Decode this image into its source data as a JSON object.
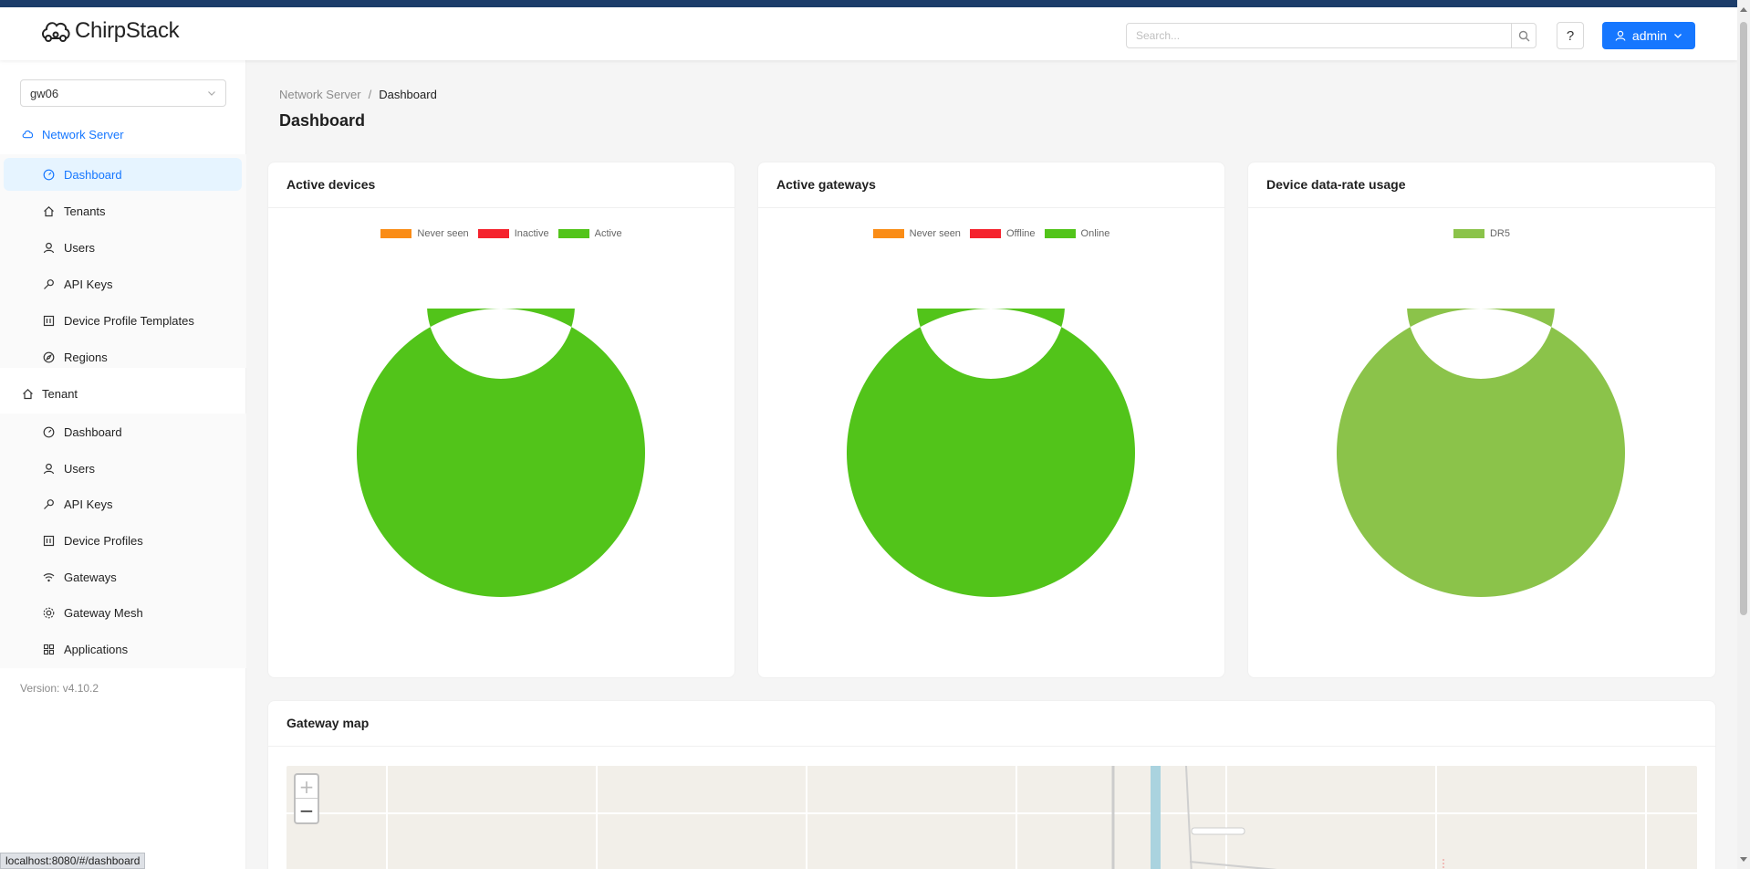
{
  "header": {
    "logo_text": "ChirpStack",
    "search_placeholder": "Search...",
    "help_label": "?",
    "user_label": "admin"
  },
  "sidebar": {
    "tenant_selected": "gw06",
    "network_server_label": "Network Server",
    "network_server_items": [
      {
        "label": "Dashboard",
        "icon": "dashboard-icon",
        "active": true
      },
      {
        "label": "Tenants",
        "icon": "home-icon"
      },
      {
        "label": "Users",
        "icon": "user-icon"
      },
      {
        "label": "API Keys",
        "icon": "key-icon"
      },
      {
        "label": "Device Profile Templates",
        "icon": "profile-icon"
      },
      {
        "label": "Regions",
        "icon": "compass-icon"
      }
    ],
    "tenant_label": "Tenant",
    "tenant_items": [
      {
        "label": "Dashboard",
        "icon": "dashboard-icon"
      },
      {
        "label": "Users",
        "icon": "user-icon"
      },
      {
        "label": "API Keys",
        "icon": "key-icon"
      },
      {
        "label": "Device Profiles",
        "icon": "profile-icon"
      },
      {
        "label": "Gateways",
        "icon": "wifi-icon"
      },
      {
        "label": "Gateway Mesh",
        "icon": "mesh-icon"
      },
      {
        "label": "Applications",
        "icon": "apps-icon"
      }
    ],
    "version": "Version: v4.10.2"
  },
  "breadcrumb": {
    "parent": "Network Server",
    "separator": "/",
    "current": "Dashboard"
  },
  "page_title": "Dashboard",
  "cards": {
    "active_devices": {
      "title": "Active devices",
      "legend": [
        {
          "label": "Never seen",
          "color": "#fa8c16"
        },
        {
          "label": "Inactive",
          "color": "#f5222d"
        },
        {
          "label": "Active",
          "color": "#52c41a"
        }
      ]
    },
    "active_gateways": {
      "title": "Active gateways",
      "legend": [
        {
          "label": "Never seen",
          "color": "#fa8c16"
        },
        {
          "label": "Offline",
          "color": "#f5222d"
        },
        {
          "label": "Online",
          "color": "#52c41a"
        }
      ]
    },
    "data_rate": {
      "title": "Device data-rate usage",
      "legend": [
        {
          "label": "DR5",
          "color": "#8bc34a"
        }
      ]
    },
    "gateway_map": {
      "title": "Gateway map",
      "zoom_in": "+",
      "zoom_out": "−"
    }
  },
  "chart_data": [
    {
      "type": "pie",
      "title": "Active devices",
      "categories": [
        "Never seen",
        "Inactive",
        "Active"
      ],
      "values": [
        0,
        0,
        1
      ],
      "colors": [
        "#fa8c16",
        "#f5222d",
        "#52c41a"
      ],
      "legend_position": "top"
    },
    {
      "type": "pie",
      "title": "Active gateways",
      "categories": [
        "Never seen",
        "Offline",
        "Online"
      ],
      "values": [
        0,
        0,
        1
      ],
      "colors": [
        "#fa8c16",
        "#f5222d",
        "#52c41a"
      ],
      "legend_position": "top"
    },
    {
      "type": "pie",
      "title": "Device data-rate usage",
      "categories": [
        "DR5"
      ],
      "values": [
        1
      ],
      "colors": [
        "#8bc34a"
      ],
      "legend_position": "top"
    }
  ],
  "status_bar_url": "localhost:8080/#/dashboard"
}
